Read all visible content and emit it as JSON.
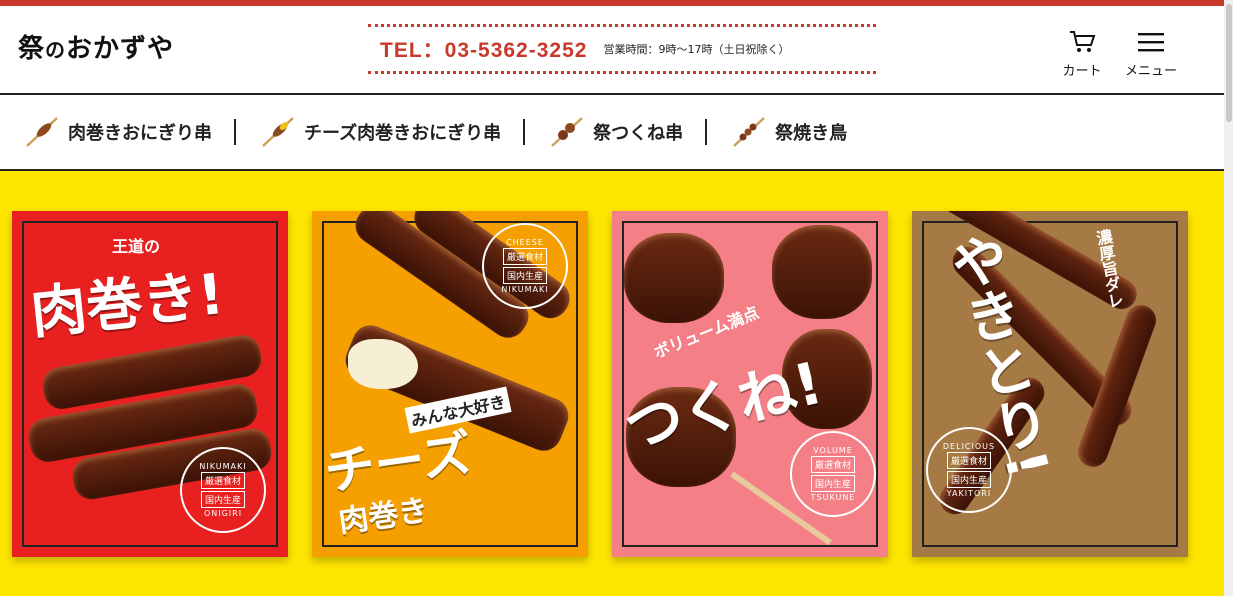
{
  "header": {
    "logo_main": "祭",
    "logo_no": "の",
    "logo_rest": "おかずや",
    "tel": "TEL：03-5362-3252",
    "hours": "営業時間：9時～17時（土日祝除く）",
    "cart_label": "カート",
    "menu_label": "メニュー"
  },
  "nav": {
    "items": [
      {
        "label": "肉巻きおにぎり串",
        "icon": "skewer-icon"
      },
      {
        "label": "チーズ肉巻きおにぎり串",
        "icon": "cheese-skewer-icon"
      },
      {
        "label": "祭つくね串",
        "icon": "tsukune-skewer-icon"
      },
      {
        "label": "祭焼き鳥",
        "icon": "yakitori-skewer-icon"
      }
    ]
  },
  "cards": [
    {
      "bg": "#e8201f",
      "tag": "王道の",
      "title": "肉巻き!",
      "stamp_top": "NIKUMAKI",
      "stamp_a": "厳選食材",
      "stamp_b": "国内生産",
      "stamp_bottom": "ONIGIRI"
    },
    {
      "bg": "#f5a000",
      "tag": "みんな大好き",
      "title": "チーズ",
      "title2": "肉巻き",
      "stamp_top": "CHEESE",
      "stamp_a": "厳選食材",
      "stamp_b": "国内生産",
      "stamp_bottom": "NIKUMAKI"
    },
    {
      "bg": "#f47f86",
      "tag": "ボリューム満点",
      "title": "つくね!",
      "stamp_top": "VOLUME",
      "stamp_a": "厳選食材",
      "stamp_b": "国内生産",
      "stamp_bottom": "TSUKUNE"
    },
    {
      "bg": "#a67a45",
      "tag": "濃厚旨ダレ",
      "title": "やきとり!",
      "stamp_top": "DELICIOUS",
      "stamp_a": "厳選食材",
      "stamp_b": "国内生産",
      "stamp_bottom": "YAKITORI"
    }
  ],
  "colors": {
    "accent": "#c8392b",
    "main_bg": "#ffe600"
  }
}
